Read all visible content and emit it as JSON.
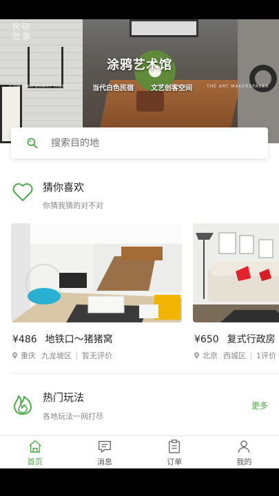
{
  "hero": {
    "logo_text": "民宿故事",
    "title": "涂鸦艺术馆",
    "subtitle_left": "当代白色民宿",
    "subtitle_right": "文艺创客空间",
    "english_left": "CONTEMPORARY HOMESTAY",
    "english_right": "THE ART MAKERSPACES"
  },
  "search": {
    "placeholder": "搜索目的地",
    "icon": "search-icon"
  },
  "recommend": {
    "title": "猜你喜欢",
    "subtitle": "你猜我猜的对不对",
    "icon": "heart-icon",
    "cards": [
      {
        "price": "¥486",
        "name": "地铁口～猪猪窝",
        "city": "重庆",
        "district": "九龙坡区",
        "rating": "暂无评价"
      },
      {
        "price": "¥650",
        "name": "复式行政房",
        "city": "北京",
        "district": "西城区",
        "rating": "1评价"
      }
    ]
  },
  "popular": {
    "title": "热门玩法",
    "subtitle": "各地玩法一网打尽",
    "more": "更多",
    "icon": "flame-icon"
  },
  "tabs": [
    {
      "label": "首页",
      "icon": "home-icon",
      "active": true
    },
    {
      "label": "消息",
      "icon": "message-icon",
      "active": false
    },
    {
      "label": "订单",
      "icon": "order-icon",
      "active": false
    },
    {
      "label": "我的",
      "icon": "user-icon",
      "active": false
    }
  ],
  "colors": {
    "accent": "#4caa47",
    "text": "#222222",
    "muted": "#888888"
  }
}
